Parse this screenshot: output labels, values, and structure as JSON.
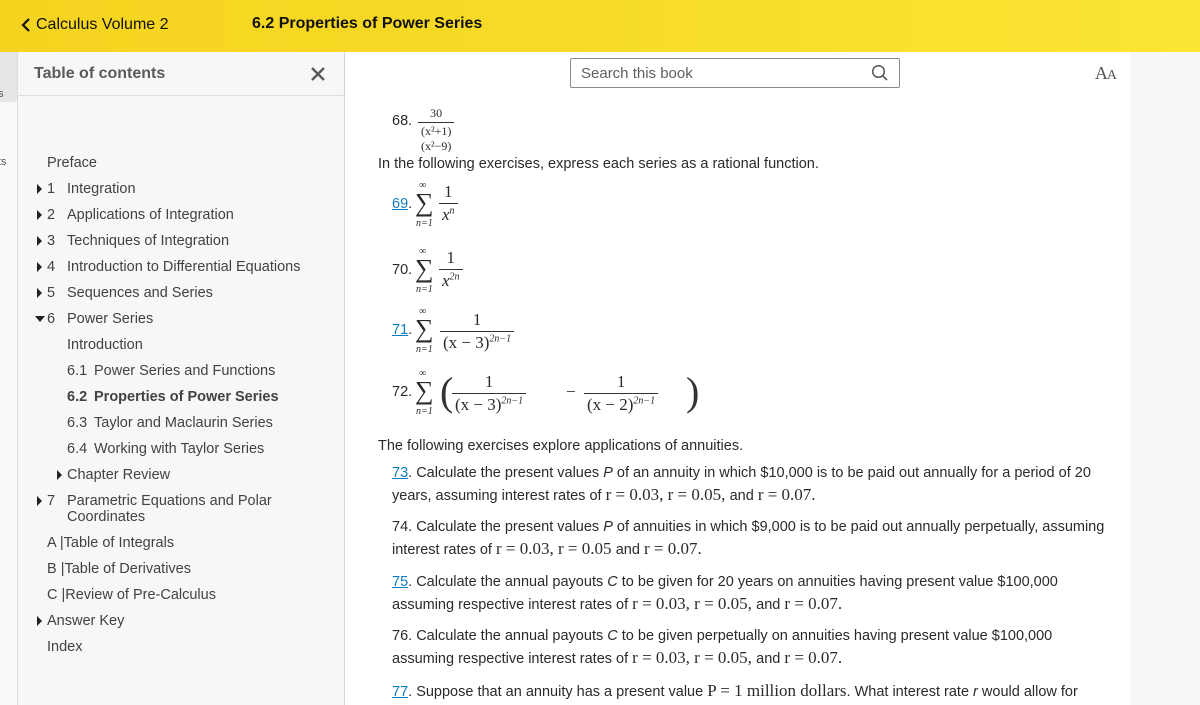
{
  "topbar": {
    "back_label": "Calculus Volume 2",
    "section_title": "6.2 Properties of Power Series",
    "colors": {
      "start": "#f5d420",
      "end": "#fbe634"
    }
  },
  "left_strip": {
    "fragments": [
      "s",
      "ts"
    ]
  },
  "sidebar": {
    "title": "Table of contents",
    "close_icon": "close-icon",
    "items": [
      {
        "label": "Preface",
        "num": "",
        "caret": "none",
        "level": 0
      },
      {
        "label": "Integration",
        "num": "1",
        "caret": "right",
        "level": 0
      },
      {
        "label": "Applications of Integration",
        "num": "2",
        "caret": "right",
        "level": 0
      },
      {
        "label": "Techniques of Integration",
        "num": "3",
        "caret": "right",
        "level": 0
      },
      {
        "label": "Introduction to Differential Equations",
        "num": "4",
        "caret": "right",
        "level": 0
      },
      {
        "label": "Sequences and Series",
        "num": "5",
        "caret": "right",
        "level": 0
      },
      {
        "label": "Power Series",
        "num": "6",
        "caret": "down",
        "level": 0
      },
      {
        "label": "Introduction",
        "num": "",
        "caret": "none",
        "level": 1
      },
      {
        "label": "Power Series and Functions",
        "num": "6.1",
        "caret": "none",
        "level": 1
      },
      {
        "label": "Properties of Power Series",
        "num": "6.2",
        "caret": "none",
        "level": 1,
        "active": true
      },
      {
        "label": "Taylor and Maclaurin Series",
        "num": "6.3",
        "caret": "none",
        "level": 1
      },
      {
        "label": "Working with Taylor Series",
        "num": "6.4",
        "caret": "none",
        "level": 1
      },
      {
        "label": "Chapter Review",
        "num": "",
        "caret": "right",
        "level": 1
      },
      {
        "label": "Parametric Equations and Polar",
        "label2": "Coordinates",
        "num": "7",
        "caret": "right",
        "level": 0
      },
      {
        "label": "A |Table of Integrals",
        "num": "",
        "caret": "none",
        "level": 0
      },
      {
        "label": "B |Table of Derivatives",
        "num": "",
        "caret": "none",
        "level": 0
      },
      {
        "label": "C |Review of Pre-Calculus",
        "num": "",
        "caret": "none",
        "level": 0
      },
      {
        "label": "Answer Key",
        "num": "",
        "caret": "right",
        "level": 0
      },
      {
        "label": "Index",
        "num": "",
        "caret": "none",
        "level": 0
      }
    ]
  },
  "toolbar": {
    "search_placeholder": "Search this book",
    "search_icon": "search-icon",
    "font_button_label": "AA"
  },
  "content": {
    "ex68": {
      "num": "68.",
      "numerator": "30",
      "denominator": "(x²+1)(x²−9)"
    },
    "intro_series": "In the following exercises, express each series as a rational function.",
    "ex69": {
      "num": "69",
      "dot": ".",
      "sum_top": "∞",
      "sum_bottom": "n=1",
      "numerator": "1",
      "den_base": "x",
      "den_exp": "n"
    },
    "ex70": {
      "num": "70.",
      "sum_top": "∞",
      "sum_bottom": "n=1",
      "numerator": "1",
      "den_base": "x",
      "den_exp": "2n"
    },
    "ex71": {
      "num": "71",
      "dot": ".",
      "sum_top": "∞",
      "sum_bottom": "n=1",
      "numerator": "1",
      "den_base": "(x − 3)",
      "den_exp": "2n−1"
    },
    "ex72": {
      "num": "72.",
      "sum_top": "∞",
      "sum_bottom": "n=1",
      "numerator1": "1",
      "den1_base": "(x − 3)",
      "den1_exp": "2n−1",
      "minus": "−",
      "numerator2": "1",
      "den2_base": "(x − 2)",
      "den2_exp": "2n−1"
    },
    "intro_annuities": "The following exercises explore applications of annuities.",
    "ex73": {
      "num": "73",
      "line1": ". Calculate the present values ",
      "var": "P",
      "line1b": " of an annuity in which $10,000 is to be paid out annually for a period of 20",
      "line2a": "years, assuming interest rates of ",
      "r1": "r = 0.03, ",
      "r2": "r = 0.05, ",
      "and": "and ",
      "r3": "r = 0.07."
    },
    "ex74": {
      "num": "74",
      "line1": ". Calculate the present values ",
      "var": "P",
      "line1b": " of annuities in which $9,000 is to be paid out annually perpetually, assuming",
      "line2a": "interest rates of ",
      "r1": "r = 0.03, ",
      "r2": "r = 0.05 ",
      "and": "and ",
      "r3": "r = 0.07."
    },
    "ex75": {
      "num": "75",
      "line1": ". Calculate the annual payouts ",
      "var": "C",
      "line1b": " to be given for 20 years on annuities having present value $100,000",
      "line2a": "assuming respective interest rates of ",
      "r1": "r = 0.03, ",
      "r2": "r = 0.05, ",
      "and": "and ",
      "r3": "r = 0.07."
    },
    "ex76": {
      "num": "76",
      "line1": ". Calculate the annual payouts ",
      "var": "C",
      "line1b": " to be given perpetually on annuities having present value $100,000",
      "line2a": "assuming respective interest rates of ",
      "r1": "r = 0.03, ",
      "r2": "r = 0.05, ",
      "and": "and ",
      "r3": "r = 0.07."
    },
    "ex77": {
      "num": "77",
      "line1": ". Suppose that an annuity has a present value ",
      "math": "P = 1 million dollars",
      "line1b": ". What interest rate ",
      "var": "r",
      "line1c": " would allow for"
    },
    "link_color": "#0c7cbf"
  }
}
